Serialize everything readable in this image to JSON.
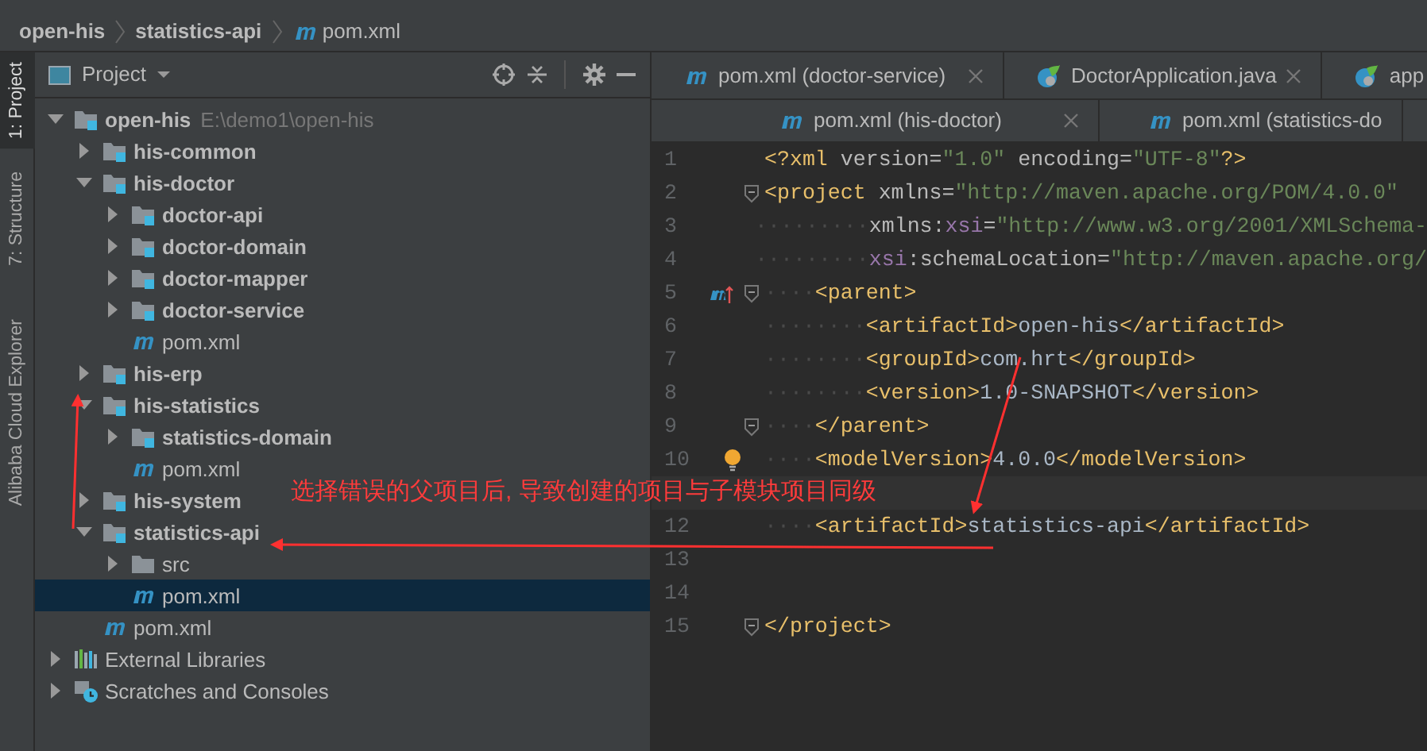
{
  "breadcrumb": [
    {
      "label": "open-his",
      "kind": "module"
    },
    {
      "label": "statistics-api",
      "kind": "module"
    },
    {
      "label": "pom.xml",
      "kind": "maven"
    }
  ],
  "tool_strip": [
    {
      "label": "1: Project",
      "selected": true
    },
    {
      "label": "7: Structure",
      "selected": false
    },
    {
      "label": "Alibaba Cloud Explorer",
      "selected": false
    }
  ],
  "project_panel": {
    "title": "Project",
    "tree": [
      {
        "label": "open-his",
        "path": "E:\\demo1\\open-his",
        "kind": "module",
        "expanded": true,
        "selected": false,
        "children": [
          {
            "label": "his-common",
            "kind": "module",
            "expanded": false,
            "selected": false
          },
          {
            "label": "his-doctor",
            "kind": "module",
            "expanded": true,
            "selected": false,
            "children": [
              {
                "label": "doctor-api",
                "kind": "module",
                "expanded": false,
                "selected": false
              },
              {
                "label": "doctor-domain",
                "kind": "module",
                "expanded": false,
                "selected": false
              },
              {
                "label": "doctor-mapper",
                "kind": "module",
                "expanded": false,
                "selected": false
              },
              {
                "label": "doctor-service",
                "kind": "module",
                "expanded": false,
                "selected": false
              },
              {
                "label": "pom.xml",
                "kind": "maven",
                "selected": false
              }
            ]
          },
          {
            "label": "his-erp",
            "kind": "module",
            "expanded": false,
            "selected": false
          },
          {
            "label": "his-statistics",
            "kind": "module",
            "expanded": true,
            "selected": false,
            "children": [
              {
                "label": "statistics-domain",
                "kind": "module",
                "expanded": false,
                "selected": false
              },
              {
                "label": "pom.xml",
                "kind": "maven",
                "selected": false
              }
            ]
          },
          {
            "label": "his-system",
            "kind": "module",
            "expanded": false,
            "selected": false
          },
          {
            "label": "statistics-api",
            "kind": "module",
            "expanded": true,
            "selected": false,
            "children": [
              {
                "label": "src",
                "kind": "folder",
                "expanded": false,
                "selected": false
              },
              {
                "label": "pom.xml",
                "kind": "maven",
                "selected": true
              }
            ]
          },
          {
            "label": "pom.xml",
            "kind": "maven",
            "selected": false
          }
        ]
      },
      {
        "label": "External Libraries",
        "kind": "libraries",
        "expanded": false,
        "selected": false
      },
      {
        "label": "Scratches and Consoles",
        "kind": "scratches",
        "expanded": false,
        "selected": false
      }
    ]
  },
  "editor_tabs": [
    [
      {
        "label": "pom.xml (doctor-service)",
        "kind": "maven",
        "closable": true
      },
      {
        "label": "DoctorApplication.java",
        "kind": "spring",
        "closable": true
      },
      {
        "label": "app",
        "kind": "spring"
      }
    ],
    [
      {
        "label": "pom.xml (his-doctor)",
        "kind": "maven",
        "closable": true
      },
      {
        "label": "pom.xml (statistics-do",
        "kind": "maven"
      }
    ]
  ],
  "code_lines": [
    {
      "number": "1",
      "segments": [
        {
          "kind": "tag",
          "text": "<?xml"
        },
        {
          "kind": "attr",
          "text": " version="
        },
        {
          "kind": "value",
          "text": "\"1.0\""
        },
        {
          "kind": "attr",
          "text": " encoding="
        },
        {
          "kind": "value",
          "text": "\"UTF-8\""
        },
        {
          "kind": "tag",
          "text": "?>"
        }
      ]
    },
    {
      "number": "2",
      "fold": true,
      "segments": [
        {
          "kind": "tag",
          "text": "<project"
        },
        {
          "kind": "attr",
          "text": " xmlns="
        },
        {
          "kind": "value",
          "text": "\"http://maven.apache.org/POM/4.0.0\""
        }
      ]
    },
    {
      "number": "3",
      "segments": [
        {
          "kind": "ws",
          "text": "·········"
        },
        {
          "kind": "attr",
          "text": "xmlns:"
        },
        {
          "kind": "ns",
          "text": "xsi"
        },
        {
          "kind": "attr",
          "text": "="
        },
        {
          "kind": "value",
          "text": "\"http://www.w3.org/2001/XMLSchema-"
        }
      ]
    },
    {
      "number": "4",
      "segments": [
        {
          "kind": "ws",
          "text": "·········"
        },
        {
          "kind": "ns",
          "text": "xsi"
        },
        {
          "kind": "attr",
          "text": ":schemaLocation="
        },
        {
          "kind": "value",
          "text": "\"http://maven.apache.org/"
        }
      ]
    },
    {
      "number": "5",
      "fold": true,
      "parent_marker": true,
      "segments": [
        {
          "kind": "ws",
          "text": "····"
        },
        {
          "kind": "tag",
          "text": "<parent>"
        }
      ]
    },
    {
      "number": "6",
      "segments": [
        {
          "kind": "ws",
          "text": "········"
        },
        {
          "kind": "tag",
          "text": "<artifactId>"
        },
        {
          "kind": "text",
          "text": "open-his"
        },
        {
          "kind": "tag",
          "text": "</artifactId>"
        }
      ]
    },
    {
      "number": "7",
      "segments": [
        {
          "kind": "ws",
          "text": "········"
        },
        {
          "kind": "tag",
          "text": "<groupId>"
        },
        {
          "kind": "text",
          "text": "com.hrt"
        },
        {
          "kind": "tag",
          "text": "</groupId>"
        }
      ]
    },
    {
      "number": "8",
      "segments": [
        {
          "kind": "ws",
          "text": "········"
        },
        {
          "kind": "tag",
          "text": "<version>"
        },
        {
          "kind": "text",
          "text": "1.0-SNAPSHOT"
        },
        {
          "kind": "tag",
          "text": "</version>"
        }
      ]
    },
    {
      "number": "9",
      "fold": true,
      "segments": [
        {
          "kind": "ws",
          "text": "····"
        },
        {
          "kind": "tag",
          "text": "</parent>"
        }
      ]
    },
    {
      "number": "10",
      "intention_bulb": true,
      "segments": [
        {
          "kind": "ws",
          "text": "····"
        },
        {
          "kind": "tag",
          "text": "<modelVersion>"
        },
        {
          "kind": "text",
          "text": "4.0.0"
        },
        {
          "kind": "tag",
          "text": "</modelVersion>"
        }
      ]
    },
    {
      "current": true
    },
    {
      "number": "12",
      "segments": [
        {
          "kind": "ws",
          "text": "····"
        },
        {
          "kind": "tag",
          "text": "<artifactId>"
        },
        {
          "kind": "text",
          "text": "statistics-api"
        },
        {
          "kind": "tag",
          "text": "</artifactId>"
        }
      ]
    },
    {
      "number": "13"
    },
    {
      "number": "14"
    },
    {
      "number": "15",
      "fold": true,
      "segments": [
        {
          "kind": "tag",
          "text": "</project>"
        }
      ]
    }
  ],
  "annotation": {
    "text": "选择错误的父项目后, 导致创建的项目与子模块项目同级"
  }
}
